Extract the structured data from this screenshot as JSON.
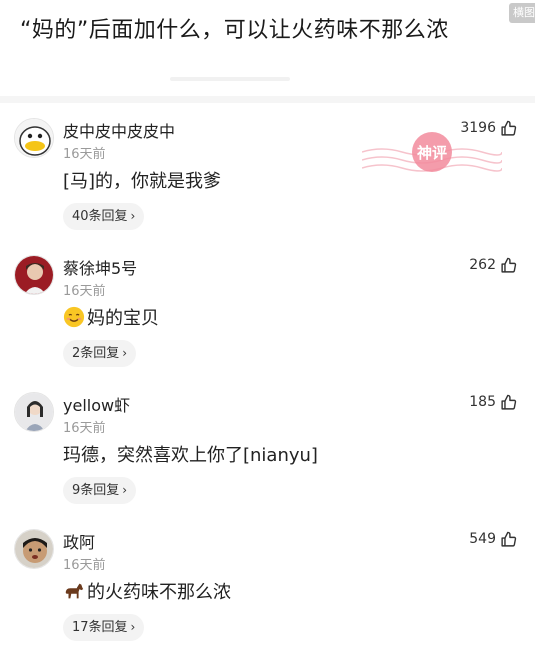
{
  "post": {
    "title": "“妈的”后面加什么，可以让火药味不那么浓",
    "corner_badge": "横图"
  },
  "watermark": {
    "text": "神评"
  },
  "comments": [
    {
      "username": "皮中皮中皮皮中",
      "time": "16天前",
      "likes": "3196",
      "content": "[马]的，你就是我爹",
      "replies": "40条回复"
    },
    {
      "username": "蔡徐坤5号",
      "time": "16天前",
      "likes": "262",
      "content": "妈的宝贝",
      "emoji": "smiling-face-icon",
      "replies": "2条回复"
    },
    {
      "username": "yellow虾",
      "time": "16天前",
      "likes": "185",
      "content": "玛德，突然喜欢上你了[nianyu]",
      "replies": "9条回复"
    },
    {
      "username": "政阿",
      "time": "16天前",
      "likes": "549",
      "content": "的火药味不那么浓",
      "emoji": "horse-icon",
      "replies": "17条回复"
    }
  ],
  "colors": {
    "reply_bg": "#f3f3f3",
    "watermark": "#f28b9c",
    "text_muted": "#9a9a9a"
  }
}
